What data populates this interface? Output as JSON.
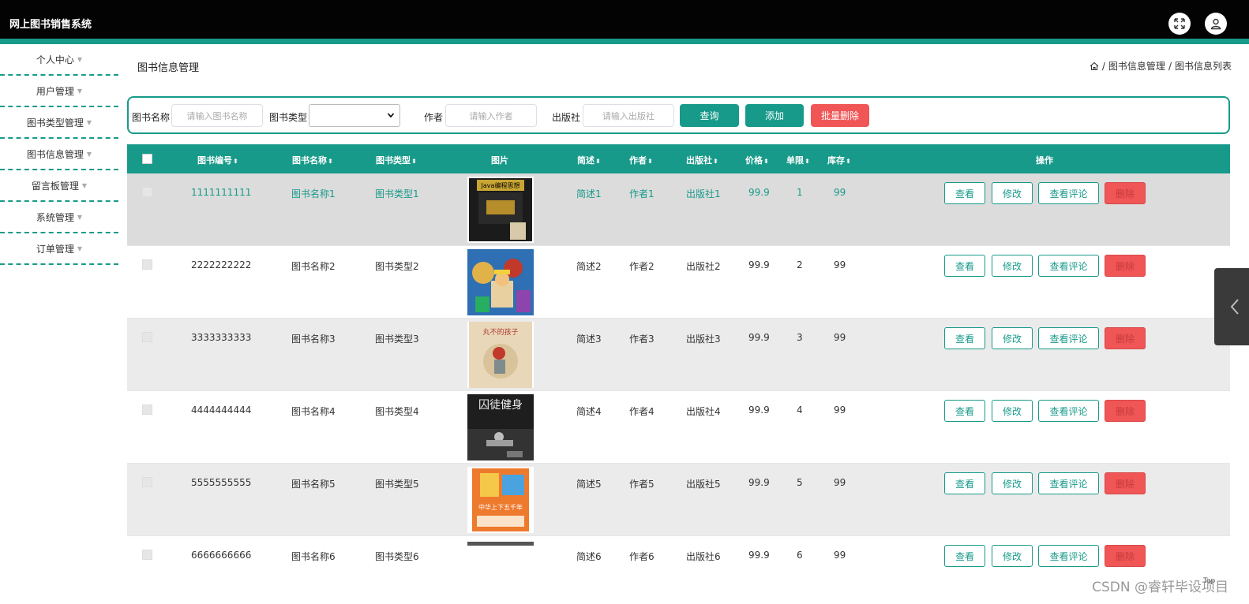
{
  "app": {
    "title": "网上图书销售系统"
  },
  "sidebar": {
    "items": [
      {
        "label": "个人中心"
      },
      {
        "label": "用户管理"
      },
      {
        "label": "图书类型管理"
      },
      {
        "label": "图书信息管理"
      },
      {
        "label": "留言板管理"
      },
      {
        "label": "系统管理"
      },
      {
        "label": "订单管理"
      }
    ]
  },
  "page": {
    "title": "图书信息管理"
  },
  "breadcrumb": {
    "level1": "图书信息管理",
    "sep": "/",
    "level2": "图书信息列表"
  },
  "search": {
    "name_label": "图书名称",
    "name_placeholder": "请输入图书名称",
    "type_label": "图书类型",
    "author_label": "作者",
    "author_placeholder": "请输入作者",
    "publisher_label": "出版社",
    "publisher_placeholder": "请输入出版社",
    "query_label": "查询",
    "add_label": "添加",
    "batch_delete_label": "批量删除"
  },
  "table": {
    "headers": {
      "code": "图书编号",
      "name": "图书名称",
      "type": "图书类型",
      "image": "图片",
      "desc": "简述",
      "author": "作者",
      "publisher": "出版社",
      "price": "价格",
      "limit": "单限",
      "stock": "库存",
      "ops": "操作"
    },
    "sort_glyph": "⬍",
    "actions": {
      "view": "查看",
      "edit": "修改",
      "comments": "查看评论",
      "delete": "删除"
    },
    "rows": [
      {
        "code": "1111111111",
        "name": "图书名称1",
        "type": "图书类型1",
        "desc": "简述1",
        "author": "作者1",
        "publisher": "出版社1",
        "price": "99.9",
        "limit": "1",
        "stock": "99",
        "cover": "Java编程思想"
      },
      {
        "code": "2222222222",
        "name": "图书名称2",
        "type": "图书类型2",
        "desc": "简述2",
        "author": "作者2",
        "publisher": "出版社2",
        "price": "99.9",
        "limit": "2",
        "stock": "99",
        "cover": ""
      },
      {
        "code": "3333333333",
        "name": "图书名称3",
        "type": "图书类型3",
        "desc": "简述3",
        "author": "作者3",
        "publisher": "出版社3",
        "price": "99.9",
        "limit": "3",
        "stock": "99",
        "cover": "丸不的孩子"
      },
      {
        "code": "4444444444",
        "name": "图书名称4",
        "type": "图书类型4",
        "desc": "简述4",
        "author": "作者4",
        "publisher": "出版社4",
        "price": "99.9",
        "limit": "4",
        "stock": "99",
        "cover": "囚徒健身"
      },
      {
        "code": "5555555555",
        "name": "图书名称5",
        "type": "图书类型5",
        "desc": "简述5",
        "author": "作者5",
        "publisher": "出版社5",
        "price": "99.9",
        "limit": "5",
        "stock": "99",
        "cover": "中华上下五千年"
      },
      {
        "code": "6666666666",
        "name": "图书名称6",
        "type": "图书类型6",
        "desc": "简述6",
        "author": "作者6",
        "publisher": "出版社6",
        "price": "99.9",
        "limit": "6",
        "stock": "99",
        "cover": ""
      }
    ]
  },
  "watermark": "CSDN @睿轩毕设项目",
  "top_button": "Top",
  "colors": {
    "accent": "#189a8a",
    "danger": "#f05656",
    "topbar": "#030303"
  }
}
